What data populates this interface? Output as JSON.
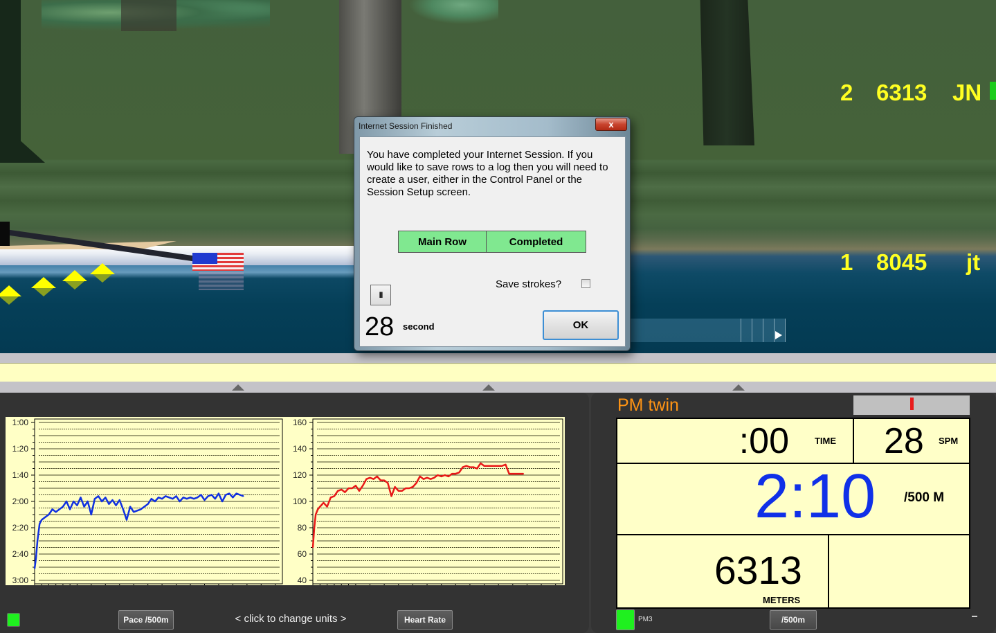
{
  "scene": {
    "standings": [
      {
        "place": "2",
        "meters": "6313",
        "name": "JN",
        "marker_color": "#1ccc1c"
      },
      {
        "place": "1",
        "meters": "8045",
        "name": "jt"
      }
    ],
    "text_color": "#ffff22"
  },
  "dialog": {
    "title": "Internet Session Finished",
    "close_label": "x",
    "message": "You have completed your Internet Session.  If you would like to save rows to a log then you will need to create a user, either in the Control Panel or the Session Setup screen.",
    "status_row": {
      "name": "Main Row",
      "value": "Completed"
    },
    "save_strokes_label": "Save strokes?",
    "save_strokes_checked": false,
    "pause_label": "II",
    "countdown_value": "28",
    "countdown_unit": "second",
    "ok_label": "OK"
  },
  "chart_panel": {
    "pace_button_label": "Pace /500m",
    "hint_label": "<  click to change units  >",
    "hr_button_label": "Heart Rate",
    "status_led_color": "#1ff01f"
  },
  "chart_data": [
    {
      "type": "line",
      "title": "",
      "xlabel": "",
      "ylabel": "Pace /500m",
      "ylim_seconds": [
        60,
        180
      ],
      "y_inverted": true,
      "y_ticks": [
        "1:00",
        "1:20",
        "1:40",
        "2:00",
        "2:20",
        "2:40",
        "3:00"
      ],
      "y_tick_values": [
        60,
        80,
        100,
        120,
        140,
        160,
        180
      ],
      "x_ticks": [
        "0",
        "10",
        "20",
        "30"
      ],
      "xlim": [
        0,
        35
      ],
      "grid": true,
      "color": "#1030e0",
      "series": [
        {
          "name": "Pace",
          "x": [
            0,
            0.2,
            0.4,
            0.7,
            1.0,
            1.5,
            2.0,
            2.5,
            3.0,
            3.5,
            4.0,
            4.5,
            5.0,
            5.5,
            6.0,
            6.5,
            7.0,
            7.5,
            8.0,
            8.5,
            9.0,
            9.5,
            10.0,
            10.5,
            11.0,
            11.5,
            12.0,
            12.5,
            13.0,
            13.5,
            14.0,
            14.5,
            15.0,
            15.5,
            16.0,
            16.5,
            17.0,
            17.5,
            18.0,
            18.5,
            19.0,
            19.5,
            20.0,
            20.5,
            21.0,
            21.5,
            22.0,
            22.5,
            23.0,
            23.5,
            24.0,
            24.5,
            25.0,
            25.5,
            26.0,
            26.5,
            27.0,
            27.5,
            28.0,
            28.5,
            29.0,
            29.5
          ],
          "y": [
            171,
            163,
            150,
            137,
            134,
            132,
            130,
            126,
            128,
            126,
            124,
            120,
            126,
            120,
            123,
            117,
            124,
            120,
            130,
            118,
            116,
            120,
            117,
            122,
            119,
            123,
            119,
            126,
            134,
            124,
            128,
            127,
            126,
            124,
            122,
            118,
            120,
            117,
            118,
            116,
            117,
            118,
            116,
            120,
            117,
            118,
            117,
            118,
            117,
            115,
            119,
            116,
            115,
            118,
            114,
            120,
            115,
            114,
            117,
            114,
            115,
            116
          ]
        }
      ]
    },
    {
      "type": "line",
      "title": "",
      "xlabel": "",
      "ylabel": "Heart Rate",
      "ylim": [
        40,
        160
      ],
      "y_ticks": [
        "40",
        "60",
        "80",
        "100",
        "120",
        "140",
        "160"
      ],
      "y_tick_values": [
        40,
        60,
        80,
        100,
        120,
        140,
        160
      ],
      "x_ticks": [
        "0",
        "10",
        "20",
        "30"
      ],
      "xlim": [
        0,
        35
      ],
      "grid": true,
      "color": "#e81818",
      "series": [
        {
          "name": "Heart Rate",
          "x": [
            0,
            0.2,
            0.4,
            0.7,
            1.0,
            1.5,
            2.0,
            2.5,
            3.0,
            3.5,
            4.0,
            4.5,
            5.0,
            5.5,
            6.0,
            6.5,
            7.0,
            7.5,
            8.0,
            8.5,
            9.0,
            9.5,
            10.0,
            10.5,
            11.0,
            11.5,
            12.0,
            12.5,
            13.0,
            13.5,
            14.0,
            14.5,
            15.0,
            15.5,
            16.0,
            16.5,
            17.0,
            17.5,
            18.0,
            18.5,
            19.0,
            19.5,
            20.0,
            20.5,
            21.0,
            21.5,
            22.0,
            22.5,
            23.0,
            23.5,
            24.0,
            24.5,
            25.0,
            25.5,
            26.0,
            26.5,
            27.0,
            27.5,
            28.0,
            28.5,
            29.0,
            29.5
          ],
          "y": [
            65,
            80,
            90,
            94,
            96,
            99,
            96,
            103,
            104,
            108,
            109,
            107,
            110,
            110,
            112,
            108,
            112,
            117,
            118,
            117,
            119,
            116,
            116,
            114,
            104,
            111,
            108,
            108,
            110,
            110,
            111,
            114,
            119,
            117,
            118,
            117,
            118,
            120,
            119,
            120,
            119,
            121,
            121,
            122,
            126,
            127,
            126,
            126,
            125,
            129,
            127,
            127,
            127,
            127,
            127,
            127,
            128,
            121,
            121,
            121,
            121,
            121
          ]
        }
      ]
    }
  ],
  "pm_panel": {
    "title": "PM twin",
    "time_value": ":00",
    "time_label": "TIME",
    "spm_value": "28",
    "spm_label": "SPM",
    "pace_value": "2:10",
    "pace_label": "/500 M",
    "pace_color": "#1030e8",
    "meters_value": "6313",
    "meters_label": "METERS",
    "model_label": "PM3",
    "unit_button_label": "/500m",
    "led_color": "#1ff01f",
    "title_color": "#ff9414"
  }
}
